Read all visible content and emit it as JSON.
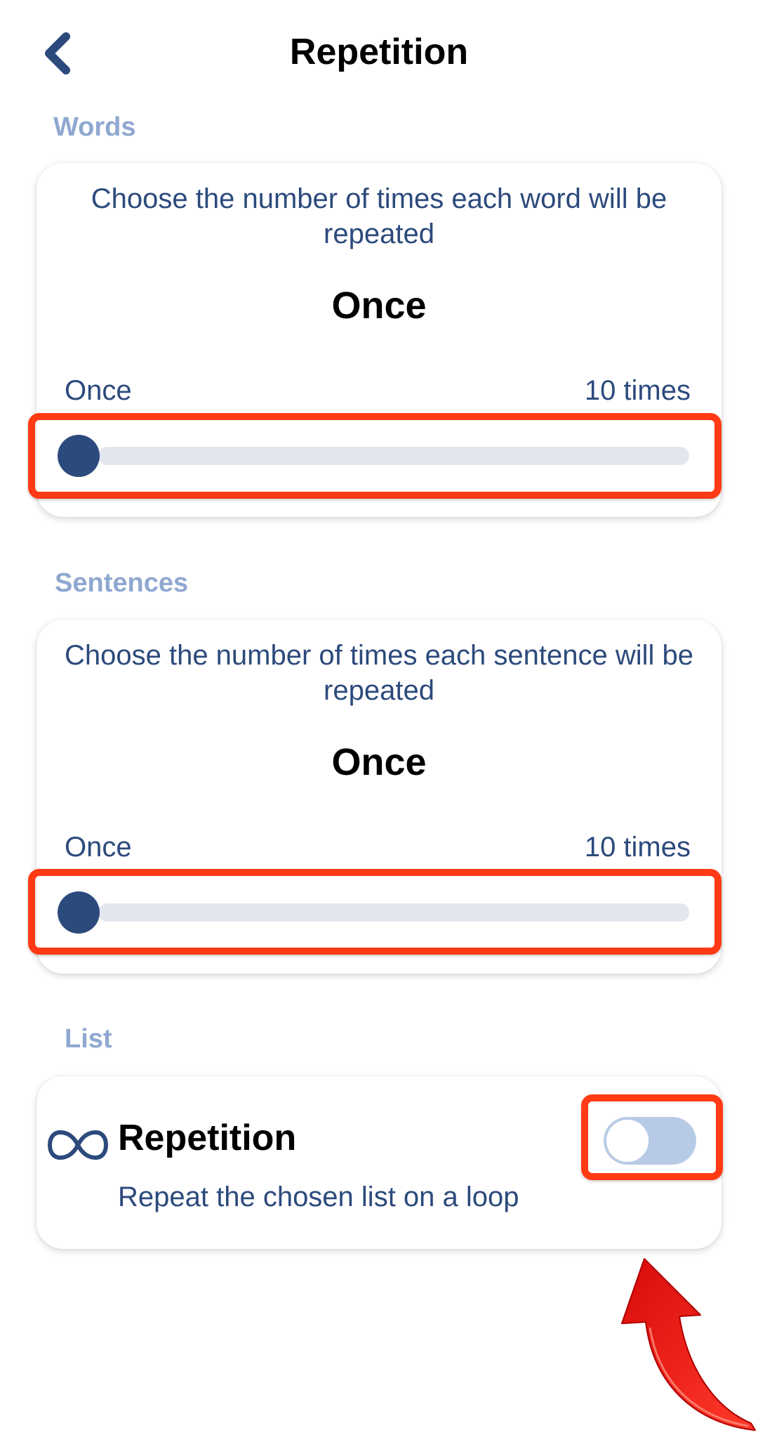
{
  "header": {
    "title": "Repetition",
    "back_icon": "chevron-left-icon"
  },
  "words": {
    "section_label": "Words",
    "description": "Choose the number of times each word will be repeated",
    "current_value": "Once",
    "min_label": "Once",
    "max_label": "10 times",
    "slider_value": 1,
    "slider_min": 1,
    "slider_max": 10
  },
  "sentences": {
    "section_label": "Sentences",
    "description": "Choose the number of times each sentence will be repeated",
    "current_value": "Once",
    "min_label": "Once",
    "max_label": "10 times",
    "slider_value": 1,
    "slider_min": 1,
    "slider_max": 10
  },
  "list": {
    "section_label": "List",
    "icon": "infinity-icon",
    "title": "Repetition",
    "subtitle": "Repeat the chosen list on a loop",
    "toggle_on": false
  },
  "colors": {
    "accent": "#2c4a7c",
    "section_label": "#8fa8d0",
    "track": "#e2e6ef",
    "toggle_off": "#b8cbe6",
    "highlight": "#ff3a14"
  }
}
